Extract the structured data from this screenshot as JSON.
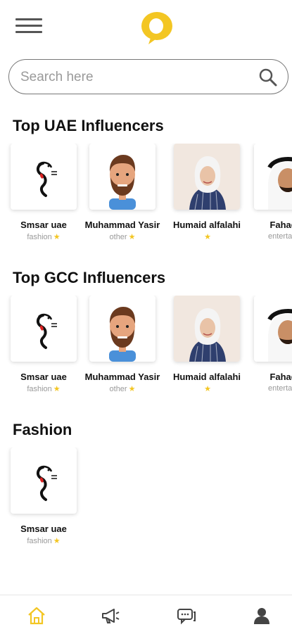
{
  "app": {
    "search_placeholder": "Search here"
  },
  "icons": {
    "menu": "hamburger-icon",
    "logo": "speech-bubble-logo",
    "search": "search-icon",
    "nav": [
      "home-icon",
      "megaphone-icon",
      "chat-icon",
      "person-icon"
    ]
  },
  "colors": {
    "accent": "#f3c623",
    "text": "#111111",
    "muted": "#999999"
  },
  "sections": [
    {
      "title": "Top UAE Influencers",
      "cards": [
        {
          "name": "Smsar uae",
          "category": "fashion",
          "star": "★"
        },
        {
          "name": "Muhammad Yasir",
          "category": "other",
          "star": "★"
        },
        {
          "name": "Humaid alfalahi",
          "category": "",
          "star": "★"
        },
        {
          "name": "Fahad a",
          "category": "entertainm",
          "star": ""
        }
      ]
    },
    {
      "title": "Top GCC Influencers",
      "cards": [
        {
          "name": "Smsar uae",
          "category": "fashion",
          "star": "★"
        },
        {
          "name": "Muhammad Yasir",
          "category": "other",
          "star": "★"
        },
        {
          "name": "Humaid alfalahi",
          "category": "",
          "star": "★"
        },
        {
          "name": "Fahad a",
          "category": "entertainm",
          "star": ""
        }
      ]
    },
    {
      "title": "Fashion",
      "cards": [
        {
          "name": "Smsar uae",
          "category": "fashion",
          "star": "★"
        }
      ]
    }
  ]
}
